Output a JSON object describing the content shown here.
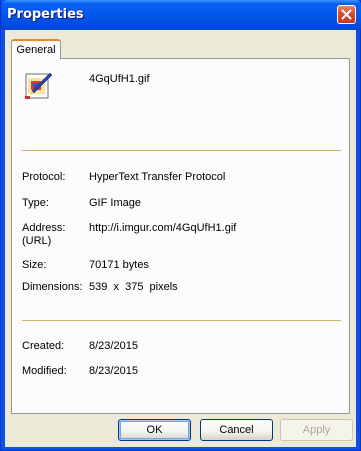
{
  "window": {
    "title": "Properties",
    "close_icon": "close-icon"
  },
  "tabs": [
    {
      "label": "General"
    }
  ],
  "file": {
    "icon": "gif-image-file-icon",
    "name": "4GqUfH1.gif"
  },
  "details": {
    "protocol": {
      "label": "Protocol:",
      "value": "HyperText Transfer Protocol"
    },
    "type": {
      "label": "Type:",
      "value": "GIF Image"
    },
    "address": {
      "label_line1": "Address:",
      "label_line2": "(URL)",
      "value": "http://i.imgur.com/4GqUfH1.gif"
    },
    "size": {
      "label": "Size:",
      "value": "70171 bytes"
    },
    "dimensions": {
      "label": "Dimensions:",
      "value": "539  x  375  pixels"
    }
  },
  "dates": {
    "created": {
      "label": "Created:",
      "value": "8/23/2015"
    },
    "modified": {
      "label": "Modified:",
      "value": "8/23/2015"
    }
  },
  "buttons": {
    "ok": "OK",
    "cancel": "Cancel",
    "apply": "Apply"
  },
  "colors": {
    "titlebar": "#0058ee",
    "tab_highlight": "#e68b2c",
    "separator": "#d0b36a",
    "dialog_face": "#ece9d8"
  }
}
